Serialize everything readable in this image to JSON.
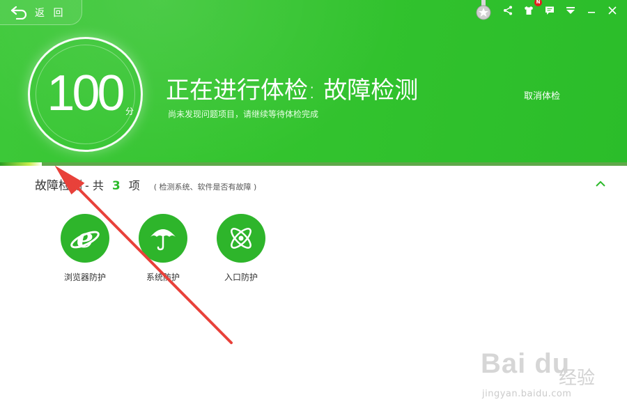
{
  "header": {
    "back_label": "返 回",
    "title": "正在进行体检: 故障检测",
    "subtitle": "尚未发现问题项目，请继续等待体检完成",
    "cancel_label": "取消体检",
    "badge_label": "N"
  },
  "score": {
    "value": "100",
    "unit": "分"
  },
  "progress": {
    "fraction": 0.067
  },
  "section": {
    "title": "故障检测",
    "separator": "- 共",
    "count": "3",
    "count_unit": "项",
    "note": "( 检测系统、软件是否有故障 )"
  },
  "items": [
    {
      "label": "浏览器防护",
      "icon": "ie-browser-icon"
    },
    {
      "label": "系统防护",
      "icon": "umbrella-icon"
    },
    {
      "label": "入口防护",
      "icon": "atom-icon"
    }
  ],
  "watermark": {
    "brand": "Bai du",
    "brand_cn": "经验",
    "url": "jingyan.baidu.com"
  },
  "colors": {
    "header_green": "#34c42f",
    "accent_green": "#2cb92a",
    "arrow_red": "#e8413a"
  }
}
